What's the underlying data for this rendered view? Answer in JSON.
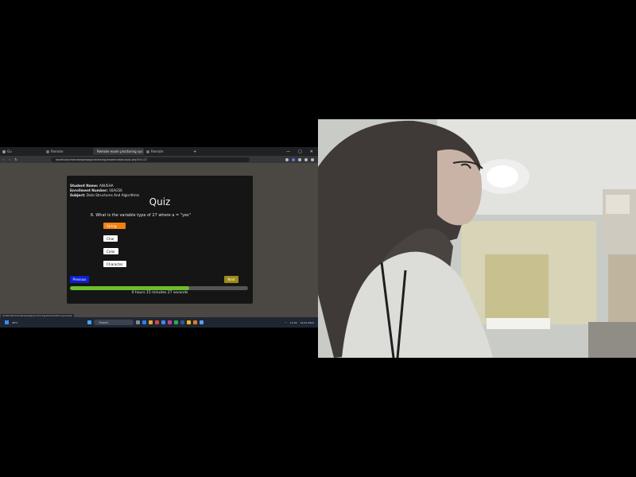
{
  "browser": {
    "tabs": [
      {
        "label": "Gu",
        "active": false
      },
      {
        "label": "Remote",
        "active": false
      },
      {
        "label": "Remote exam proctoring sys",
        "active": true
      },
      {
        "label": "Remote",
        "active": false
      }
    ],
    "new_tab_icon": "plus-icon",
    "url": "localhost/chandanqd/app/proctoring/examination/quiz.php?id=27",
    "window_controls": [
      "—",
      "▢",
      "✕"
    ]
  },
  "quiz": {
    "student_name_label": "Student Name:",
    "student_name": "ANUSHA",
    "enrollment_label": "Enrollment Number:",
    "enrollment": "16AG56",
    "subject_label": "Subject:",
    "subject": "Data Structures And Algorithms",
    "title": "Quiz",
    "question": "6. What is the variable type of 27 where a = \"yes\"",
    "options": [
      "String",
      "Char",
      "Color",
      "Character"
    ],
    "selected_index": 0,
    "previous_label": "Previous",
    "next_label": "Next",
    "progress_fraction": 0.67,
    "timer": "0 hours 15 minutes 27 seconds"
  },
  "status_url": "localhost/chandanqd/app/proctoring/examination/quiz.php",
  "taskbar": {
    "weather": "28°C",
    "search_placeholder": "Search",
    "time": "11:24",
    "date": "12-01-2024"
  },
  "colors": {
    "quiz_bg": "#151515",
    "page_bg": "#4b4844",
    "selected_option": "#f2800f",
    "previous_button": "#0e1fd0",
    "next_button": "#9c8a1a",
    "progress_fill": "#6cbf2c"
  }
}
